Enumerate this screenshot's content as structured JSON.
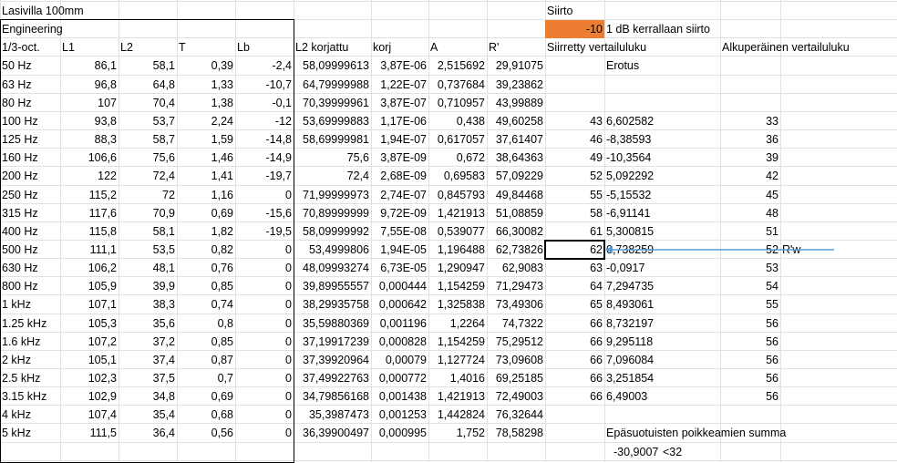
{
  "colors": {
    "orange_cell": "#ed7d31",
    "grid": "#e1e1e1",
    "arrow": "#5b9bd5"
  },
  "title": "Lasivilla 100mm",
  "engineering_label": "Engineering",
  "headers": [
    "1/3-oct.",
    "L1",
    "L2",
    "T",
    "Lb",
    "L2 korjattu",
    "korj",
    "A",
    "R'"
  ],
  "siirto": {
    "label": "Siirto",
    "value": "-10",
    "description": "1 dB kerrallaan siirto"
  },
  "right_headers": {
    "shifted": "Siirretty vertailuluku",
    "original": "Alkuperäinen vertailuluku",
    "difference": "Erotus"
  },
  "rw_label": "R'w",
  "summary": {
    "label": "Epäsuotuisten poikkeamien summa",
    "value": "-30,9007",
    "condition": "<32"
  },
  "rows": [
    {
      "freq": "50 Hz",
      "L1": "86,1",
      "L2": "58,1",
      "T": "0,39",
      "Lb": "-2,4",
      "L2k": "58,09999613",
      "korj": "3,87E-06",
      "A": "2,515692",
      "R": "29,91075",
      "shift": "",
      "diff": "",
      "orig": ""
    },
    {
      "freq": "63 Hz",
      "L1": "96,8",
      "L2": "64,8",
      "T": "1,33",
      "Lb": "-10,7",
      "L2k": "64,79999988",
      "korj": "1,22E-07",
      "A": "0,737684",
      "R": "39,23862",
      "shift": "",
      "diff": "",
      "orig": ""
    },
    {
      "freq": "80 Hz",
      "L1": "107",
      "L2": "70,4",
      "T": "1,38",
      "Lb": "-0,1",
      "L2k": "70,39999961",
      "korj": "3,87E-07",
      "A": "0,710957",
      "R": "43,99889",
      "shift": "",
      "diff": "",
      "orig": ""
    },
    {
      "freq": "100 Hz",
      "L1": "93,8",
      "L2": "53,7",
      "T": "2,24",
      "Lb": "-12",
      "L2k": "53,69999883",
      "korj": "1,17E-06",
      "A": "0,438",
      "R": "49,60258",
      "shift": "43",
      "diff": "6,602582",
      "orig": "33"
    },
    {
      "freq": "125 Hz",
      "L1": "88,3",
      "L2": "58,7",
      "T": "1,59",
      "Lb": "-14,8",
      "L2k": "58,69999981",
      "korj": "1,94E-07",
      "A": "0,617057",
      "R": "37,61407",
      "shift": "46",
      "diff": "-8,38593",
      "orig": "36"
    },
    {
      "freq": "160 Hz",
      "L1": "106,6",
      "L2": "75,6",
      "T": "1,46",
      "Lb": "-14,9",
      "L2k": "75,6",
      "korj": "3,87E-09",
      "A": "0,672",
      "R": "38,64363",
      "shift": "49",
      "diff": "-10,3564",
      "orig": "39"
    },
    {
      "freq": "200 Hz",
      "L1": "122",
      "L2": "72,4",
      "T": "1,41",
      "Lb": "-19,7",
      "L2k": "72,4",
      "korj": "2,68E-09",
      "A": "0,69583",
      "R": "57,09229",
      "shift": "52",
      "diff": "5,092292",
      "orig": "42"
    },
    {
      "freq": "250 Hz",
      "L1": "115,2",
      "L2": "72",
      "T": "1,16",
      "Lb": "0",
      "L2k": "71,99999973",
      "korj": "2,74E-07",
      "A": "0,845793",
      "R": "49,84468",
      "shift": "55",
      "diff": "-5,15532",
      "orig": "45"
    },
    {
      "freq": "315 Hz",
      "L1": "117,6",
      "L2": "70,9",
      "T": "0,69",
      "Lb": "-15,6",
      "L2k": "70,89999999",
      "korj": "9,72E-09",
      "A": "1,421913",
      "R": "51,08859",
      "shift": "58",
      "diff": "-6,91141",
      "orig": "48"
    },
    {
      "freq": "400 Hz",
      "L1": "115,8",
      "L2": "58,1",
      "T": "1,82",
      "Lb": "-19,5",
      "L2k": "58,09999992",
      "korj": "7,55E-08",
      "A": "0,539077",
      "R": "66,30082",
      "shift": "61",
      "diff": "5,300815",
      "orig": "51"
    },
    {
      "freq": "500 Hz",
      "L1": "111,1",
      "L2": "53,5",
      "T": "0,82",
      "Lb": "0",
      "L2k": "53,4999806",
      "korj": "1,94E-05",
      "A": "1,196488",
      "R": "62,73826",
      "shift": "62",
      "diff": "0,738259",
      "orig": "52"
    },
    {
      "freq": "630 Hz",
      "L1": "106,2",
      "L2": "48,1",
      "T": "0,76",
      "Lb": "0",
      "L2k": "48,09993274",
      "korj": "6,73E-05",
      "A": "1,290947",
      "R": "62,9083",
      "shift": "63",
      "diff": "-0,0917",
      "orig": "53"
    },
    {
      "freq": "800 Hz",
      "L1": "105,9",
      "L2": "39,9",
      "T": "0,85",
      "Lb": "0",
      "L2k": "39,89955557",
      "korj": "0,000444",
      "A": "1,154259",
      "R": "71,29473",
      "shift": "64",
      "diff": "7,294735",
      "orig": "54"
    },
    {
      "freq": "1 kHz",
      "L1": "107,1",
      "L2": "38,3",
      "T": "0,74",
      "Lb": "0",
      "L2k": "38,29935758",
      "korj": "0,000642",
      "A": "1,325838",
      "R": "73,49306",
      "shift": "65",
      "diff": "8,493061",
      "orig": "55"
    },
    {
      "freq": "1.25 kHz",
      "L1": "105,3",
      "L2": "35,6",
      "T": "0,8",
      "Lb": "0",
      "L2k": "35,59880369",
      "korj": "0,001196",
      "A": "1,2264",
      "R": "74,7322",
      "shift": "66",
      "diff": "8,732197",
      "orig": "56"
    },
    {
      "freq": "1.6 kHz",
      "L1": "107,2",
      "L2": "37,2",
      "T": "0,85",
      "Lb": "0",
      "L2k": "37,19917239",
      "korj": "0,000828",
      "A": "1,154259",
      "R": "75,29512",
      "shift": "66",
      "diff": "9,295118",
      "orig": "56"
    },
    {
      "freq": "2 kHz",
      "L1": "105,1",
      "L2": "37,4",
      "T": "0,87",
      "Lb": "0",
      "L2k": "37,39920964",
      "korj": "0,00079",
      "A": "1,127724",
      "R": "73,09608",
      "shift": "66",
      "diff": "7,096084",
      "orig": "56"
    },
    {
      "freq": "2.5 kHz",
      "L1": "102,3",
      "L2": "37,5",
      "T": "0,7",
      "Lb": "0",
      "L2k": "37,49922763",
      "korj": "0,000772",
      "A": "1,4016",
      "R": "69,25185",
      "shift": "66",
      "diff": "3,251854",
      "orig": "56"
    },
    {
      "freq": "3.15 kHz",
      "L1": "102,9",
      "L2": "34,8",
      "T": "0,69",
      "Lb": "0",
      "L2k": "34,79856168",
      "korj": "0,001438",
      "A": "1,421913",
      "R": "72,49003",
      "shift": "66",
      "diff": "6,49003",
      "orig": "56"
    },
    {
      "freq": "4 kHz",
      "L1": "107,4",
      "L2": "35,4",
      "T": "0,68",
      "Lb": "0",
      "L2k": "35,3987473",
      "korj": "0,001253",
      "A": "1,442824",
      "R": "76,32644",
      "shift": "",
      "diff": "",
      "orig": ""
    },
    {
      "freq": "5 kHz",
      "L1": "111,5",
      "L2": "36,4",
      "T": "0,56",
      "Lb": "0",
      "L2k": "36,39900497",
      "korj": "0,000995",
      "A": "1,752",
      "R": "78,58298",
      "shift": "",
      "diff": "",
      "orig": ""
    }
  ]
}
